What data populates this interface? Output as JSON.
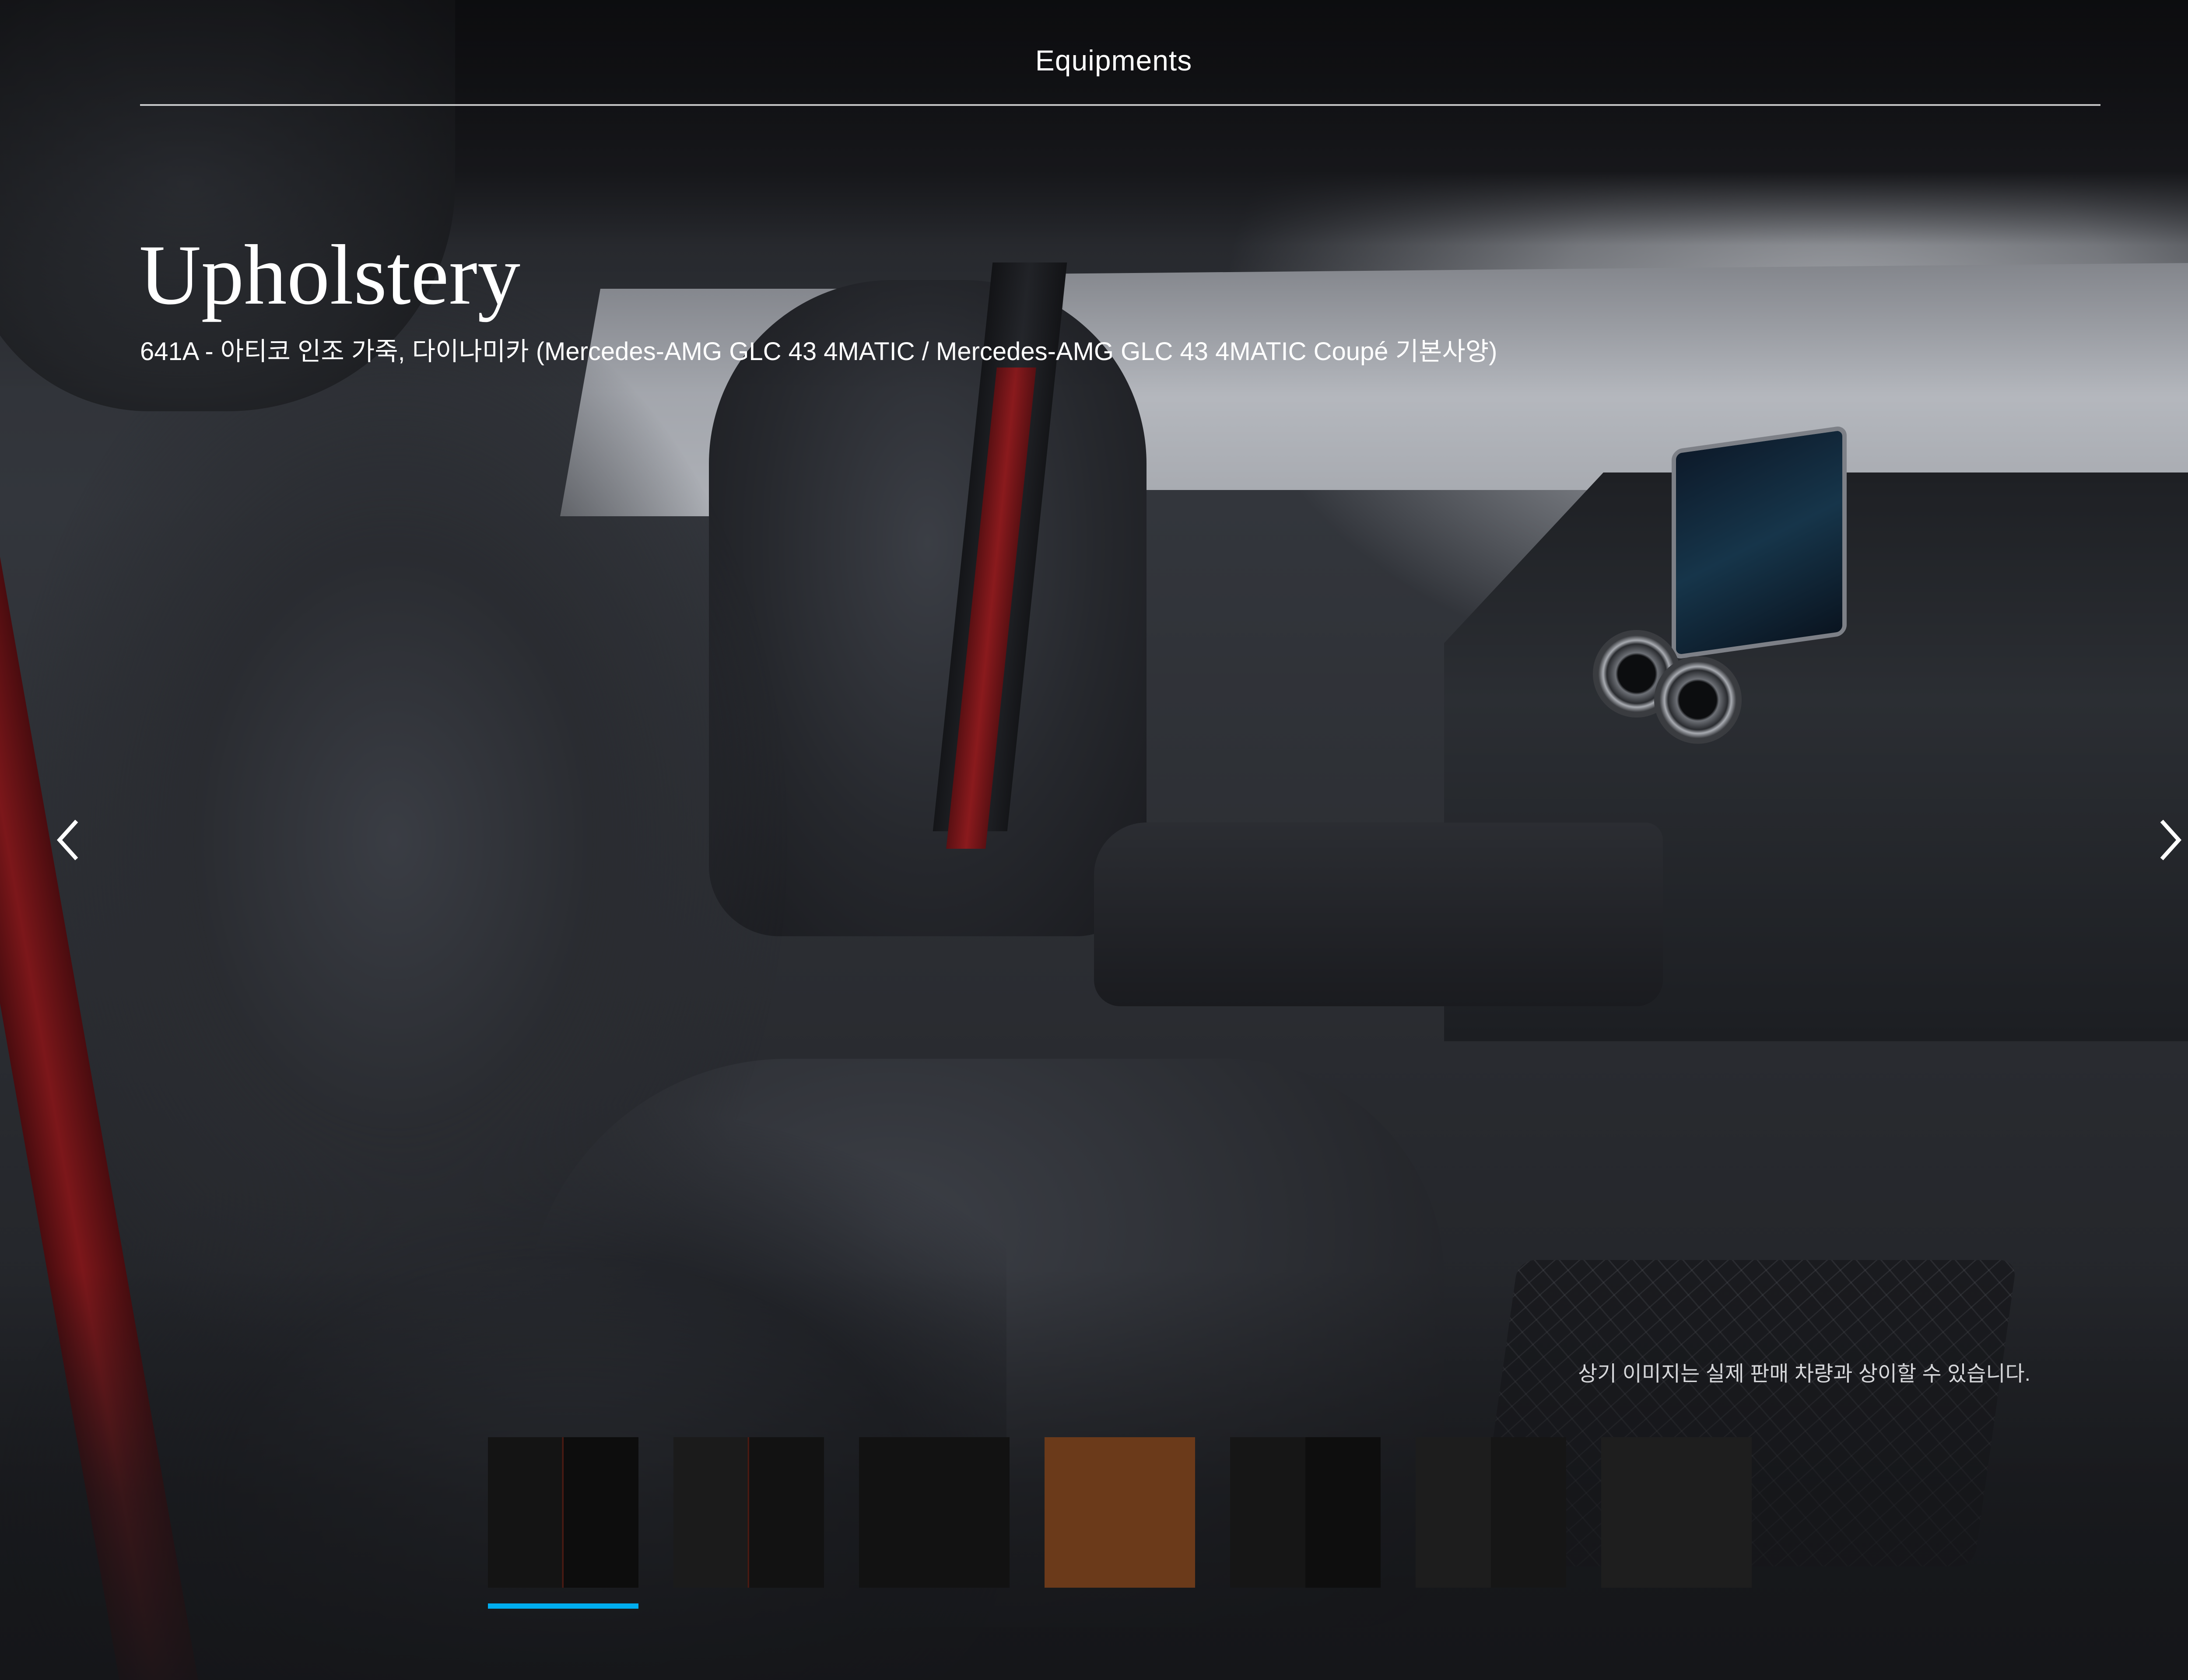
{
  "header": {
    "title": "Equipments"
  },
  "main": {
    "title": "Upholstery",
    "subtitle": "641A - 아티코 인조 가죽, 다이나미카 (Mercedes-AMG GLC 43 4MATIC / Mercedes-AMG GLC 43 4MATIC Coupé 기본사양)",
    "disclaimer": "상기 이미지는 실제 판매 차량과 상이할 수 있습니다."
  },
  "navigation": {
    "prev_icon": "chevron-left-icon",
    "next_icon": "chevron-right-icon"
  },
  "swatches": {
    "selected_index": 0,
    "indicator_color": "#00adef",
    "items": [
      {
        "color": "#141414",
        "accent": "#0d0d0d",
        "accent_line": "#4a1a12"
      },
      {
        "color": "#1b1b1b",
        "accent": "#121212",
        "accent_line": "#4a1a12"
      },
      {
        "color": "#121212",
        "accent": "#121212",
        "accent_line": ""
      },
      {
        "color": "#6b3a1a",
        "accent": "#6b3a1a",
        "accent_line": ""
      },
      {
        "color": "#161616",
        "accent": "#0e0e0e",
        "accent_line": ""
      },
      {
        "color": "#1d1d1d",
        "accent": "#161616",
        "accent_line": ""
      },
      {
        "color": "#1e1e1e",
        "accent": "#1e1e1e",
        "accent_line": ""
      }
    ]
  }
}
